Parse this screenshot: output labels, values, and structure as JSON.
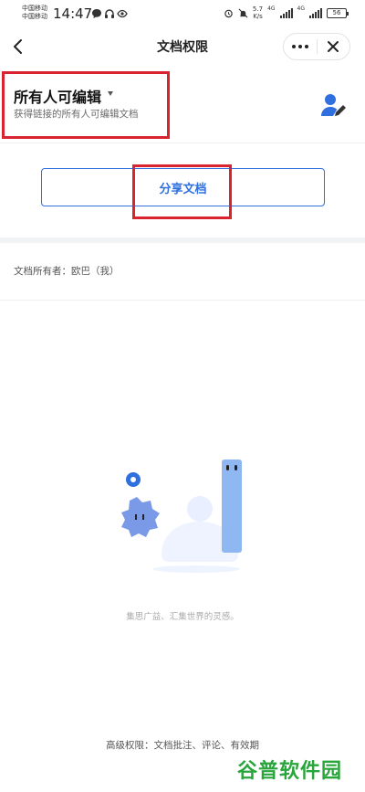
{
  "status_bar": {
    "carrier_1": "中国移动",
    "carrier_2": "中国移动",
    "time": "14:47",
    "speed_value": "5.7",
    "speed_unit": "K/s",
    "net_1": "4G",
    "net_2": "4G",
    "battery": "56"
  },
  "nav": {
    "title": "文档权限"
  },
  "permission": {
    "title": "所有人可编辑",
    "subtitle": "获得链接的所有人可编辑文档"
  },
  "share": {
    "label": "分享文档"
  },
  "owner_text": "文档所有者：欧巴（我）",
  "empty_text": "集思广益、汇集世界的灵感。",
  "bottom_text": "高级权限：文档批注、评论、有效期",
  "watermark": "谷普软件园",
  "colors": {
    "accent": "#2f6fdf",
    "highlight_box": "#d9232e",
    "watermark": "#2aa53c"
  }
}
